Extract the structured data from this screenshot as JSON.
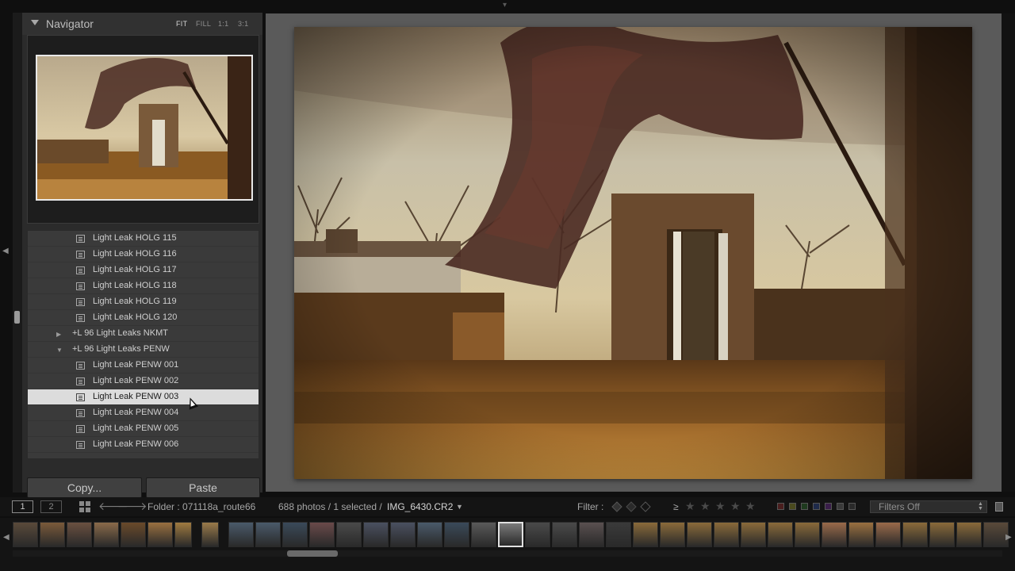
{
  "navigator": {
    "title": "Navigator",
    "zoom_options": [
      "FIT",
      "FILL",
      "1:1",
      "3:1"
    ],
    "active_zoom": "FIT"
  },
  "presets": [
    {
      "label": "Light Leak HOLG 115",
      "type": "preset"
    },
    {
      "label": "Light Leak HOLG 116",
      "type": "preset"
    },
    {
      "label": "Light Leak HOLG 117",
      "type": "preset"
    },
    {
      "label": "Light Leak HOLG 118",
      "type": "preset"
    },
    {
      "label": "Light Leak HOLG 119",
      "type": "preset"
    },
    {
      "label": "Light Leak HOLG 120",
      "type": "preset"
    },
    {
      "label": "+L 96 Light Leaks NKMT",
      "type": "folder",
      "expanded": false
    },
    {
      "label": "+L 96 Light Leaks PENW",
      "type": "folder",
      "expanded": true
    },
    {
      "label": "Light Leak PENW 001",
      "type": "preset"
    },
    {
      "label": "Light Leak PENW 002",
      "type": "preset"
    },
    {
      "label": "Light Leak PENW 003",
      "type": "preset",
      "selected": true
    },
    {
      "label": "Light Leak PENW 004",
      "type": "preset"
    },
    {
      "label": "Light Leak PENW 005",
      "type": "preset"
    },
    {
      "label": "Light Leak PENW 006",
      "type": "preset"
    }
  ],
  "buttons": {
    "copy": "Copy...",
    "paste": "Paste"
  },
  "toolbar": {
    "view1": "1",
    "view2": "2",
    "folder": "Folder : 071118a_route66",
    "count": "688 photos / 1 selected /",
    "filename": "IMG_6430.CR2",
    "filter_label": "Filter :",
    "rating_op": "≥",
    "filters_value": "Filters Off"
  },
  "colors": {
    "accent_selected": "#dcdcdc",
    "panel_bg": "#2b2b2b",
    "center_bg": "#5a5a5a",
    "toolbar_bg": "#141414"
  }
}
